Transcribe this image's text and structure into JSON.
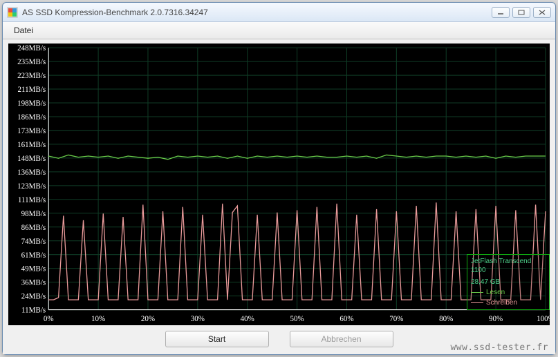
{
  "window": {
    "title": "AS SSD Kompression-Benchmark 2.0.7316.34247"
  },
  "menu": {
    "file": "Datei"
  },
  "buttons": {
    "start": "Start",
    "cancel": "Abbrechen"
  },
  "info": {
    "device": "JetFlash Transcend 1100",
    "capacity": "28,47 GB"
  },
  "legend": {
    "read": "Lesen",
    "write": "Schreiben"
  },
  "colors": {
    "read": "#6bcf4a",
    "write": "#e99a9a",
    "grid": "#0f3d26",
    "axis": "#ffffff"
  },
  "watermark": "www.ssd-tester.fr",
  "chart_data": {
    "type": "line",
    "xlabel": "",
    "ylabel": "",
    "xlim": [
      0,
      100
    ],
    "ylim": [
      11,
      248
    ],
    "x_ticks": [
      "0%",
      "10%",
      "20%",
      "30%",
      "40%",
      "50%",
      "60%",
      "70%",
      "80%",
      "90%",
      "100%"
    ],
    "y_ticks": [
      "248MB/s",
      "235MB/s",
      "223MB/s",
      "211MB/s",
      "198MB/s",
      "186MB/s",
      "173MB/s",
      "161MB/s",
      "148MB/s",
      "136MB/s",
      "123MB/s",
      "111MB/s",
      "98MB/s",
      "86MB/s",
      "74MB/s",
      "61MB/s",
      "49MB/s",
      "36MB/s",
      "24MB/s",
      "11MB/s"
    ],
    "series": [
      {
        "name": "Lesen",
        "color": "#6bcf4a",
        "points": [
          [
            0,
            150
          ],
          [
            2,
            148
          ],
          [
            4,
            151
          ],
          [
            6,
            149
          ],
          [
            8,
            150
          ],
          [
            10,
            149
          ],
          [
            12,
            150
          ],
          [
            14,
            148
          ],
          [
            16,
            150
          ],
          [
            18,
            149
          ],
          [
            20,
            148
          ],
          [
            22,
            149
          ],
          [
            24,
            147
          ],
          [
            26,
            150
          ],
          [
            28,
            149
          ],
          [
            30,
            150
          ],
          [
            32,
            149
          ],
          [
            34,
            150
          ],
          [
            36,
            148
          ],
          [
            38,
            150
          ],
          [
            40,
            148
          ],
          [
            42,
            150
          ],
          [
            44,
            149
          ],
          [
            46,
            150
          ],
          [
            48,
            149
          ],
          [
            50,
            150
          ],
          [
            52,
            149
          ],
          [
            54,
            150
          ],
          [
            56,
            149
          ],
          [
            58,
            149
          ],
          [
            60,
            150
          ],
          [
            62,
            149
          ],
          [
            64,
            150
          ],
          [
            66,
            148
          ],
          [
            68,
            151
          ],
          [
            70,
            150
          ],
          [
            72,
            149
          ],
          [
            74,
            150
          ],
          [
            76,
            149
          ],
          [
            78,
            150
          ],
          [
            80,
            150
          ],
          [
            82,
            149
          ],
          [
            84,
            150
          ],
          [
            86,
            149
          ],
          [
            88,
            150
          ],
          [
            90,
            148
          ],
          [
            92,
            150
          ],
          [
            94,
            149
          ],
          [
            96,
            150
          ],
          [
            98,
            150
          ],
          [
            100,
            150
          ]
        ]
      },
      {
        "name": "Schreiben",
        "color": "#e99a9a",
        "points": [
          [
            0,
            20
          ],
          [
            1,
            20
          ],
          [
            2,
            22
          ],
          [
            3,
            96
          ],
          [
            4,
            20
          ],
          [
            5,
            20
          ],
          [
            6,
            20
          ],
          [
            7,
            92
          ],
          [
            8,
            20
          ],
          [
            9,
            20
          ],
          [
            10,
            20
          ],
          [
            11,
            98
          ],
          [
            12,
            20
          ],
          [
            13,
            20
          ],
          [
            14,
            20
          ],
          [
            15,
            95
          ],
          [
            16,
            20
          ],
          [
            17,
            20
          ],
          [
            18,
            20
          ],
          [
            19,
            106
          ],
          [
            20,
            20
          ],
          [
            21,
            20
          ],
          [
            22,
            20
          ],
          [
            23,
            100
          ],
          [
            24,
            20
          ],
          [
            25,
            20
          ],
          [
            26,
            20
          ],
          [
            27,
            104
          ],
          [
            28,
            20
          ],
          [
            29,
            20
          ],
          [
            30,
            20
          ],
          [
            31,
            97
          ],
          [
            32,
            20
          ],
          [
            33,
            20
          ],
          [
            34,
            20
          ],
          [
            35,
            107
          ],
          [
            36,
            20
          ],
          [
            37,
            99
          ],
          [
            38,
            105
          ],
          [
            39,
            20
          ],
          [
            40,
            20
          ],
          [
            41,
            20
          ],
          [
            42,
            97
          ],
          [
            43,
            20
          ],
          [
            44,
            20
          ],
          [
            45,
            20
          ],
          [
            46,
            99
          ],
          [
            47,
            20
          ],
          [
            48,
            20
          ],
          [
            49,
            20
          ],
          [
            50,
            101
          ],
          [
            51,
            20
          ],
          [
            52,
            20
          ],
          [
            53,
            20
          ],
          [
            54,
            104
          ],
          [
            55,
            20
          ],
          [
            56,
            20
          ],
          [
            57,
            20
          ],
          [
            58,
            107
          ],
          [
            59,
            20
          ],
          [
            60,
            20
          ],
          [
            61,
            20
          ],
          [
            62,
            97
          ],
          [
            63,
            20
          ],
          [
            64,
            20
          ],
          [
            65,
            20
          ],
          [
            66,
            102
          ],
          [
            67,
            20
          ],
          [
            68,
            20
          ],
          [
            69,
            20
          ],
          [
            70,
            100
          ],
          [
            71,
            20
          ],
          [
            72,
            20
          ],
          [
            73,
            20
          ],
          [
            74,
            105
          ],
          [
            75,
            20
          ],
          [
            76,
            20
          ],
          [
            77,
            20
          ],
          [
            78,
            108
          ],
          [
            79,
            20
          ],
          [
            80,
            20
          ],
          [
            81,
            20
          ],
          [
            82,
            100
          ],
          [
            83,
            20
          ],
          [
            84,
            20
          ],
          [
            85,
            20
          ],
          [
            86,
            102
          ],
          [
            87,
            20
          ],
          [
            88,
            20
          ],
          [
            89,
            20
          ],
          [
            90,
            105
          ],
          [
            91,
            20
          ],
          [
            92,
            20
          ],
          [
            93,
            20
          ],
          [
            94,
            101
          ],
          [
            95,
            20
          ],
          [
            96,
            20
          ],
          [
            97,
            20
          ],
          [
            98,
            106
          ],
          [
            99,
            20
          ],
          [
            100,
            100
          ]
        ]
      }
    ]
  }
}
